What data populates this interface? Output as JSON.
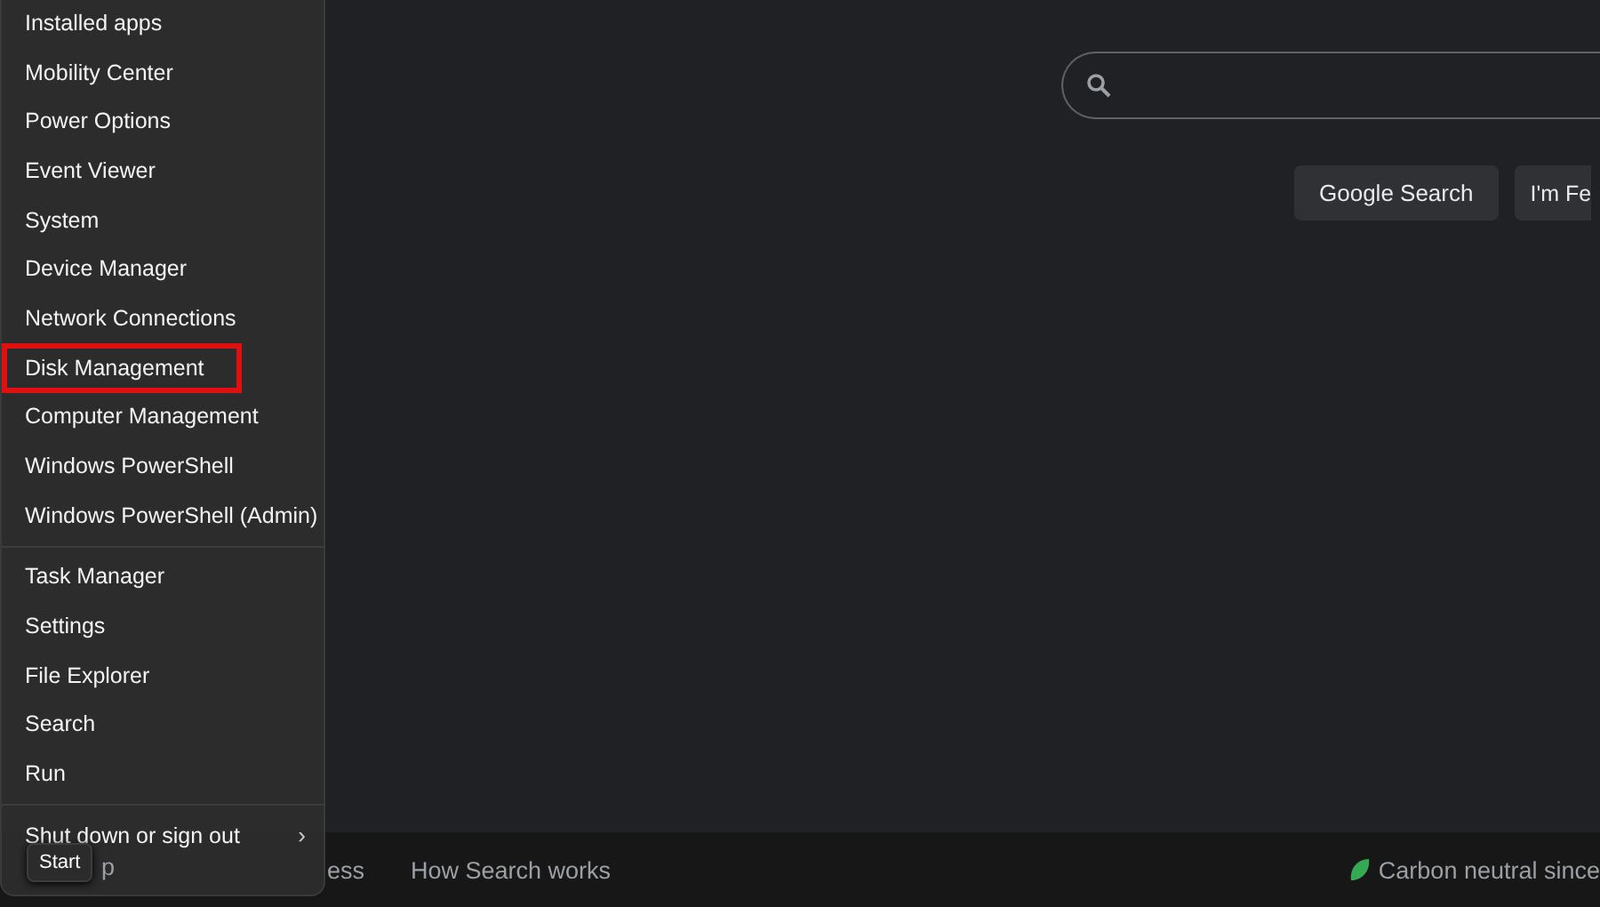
{
  "search_page": {
    "buttons": [
      "Google Search",
      "I'm Fe"
    ]
  },
  "footer": {
    "links": [
      "p",
      "ess",
      "How Search works"
    ],
    "carbon": "Carbon neutral since"
  },
  "start_menu": {
    "groups": [
      {
        "items": [
          {
            "label": "Installed apps",
            "highlighted": false
          },
          {
            "label": "Mobility Center",
            "highlighted": false
          },
          {
            "label": "Power Options",
            "highlighted": false
          },
          {
            "label": "Event Viewer",
            "highlighted": false
          },
          {
            "label": "System",
            "highlighted": false
          },
          {
            "label": "Device Manager",
            "highlighted": false
          },
          {
            "label": "Network Connections",
            "highlighted": false
          },
          {
            "label": "Disk Management",
            "highlighted": true
          },
          {
            "label": "Computer Management",
            "highlighted": false
          },
          {
            "label": "Windows PowerShell",
            "highlighted": false
          },
          {
            "label": "Windows PowerShell (Admin)",
            "highlighted": false
          }
        ]
      },
      {
        "items": [
          {
            "label": "Task Manager",
            "highlighted": false
          },
          {
            "label": "Settings",
            "highlighted": false
          },
          {
            "label": "File Explorer",
            "highlighted": false
          },
          {
            "label": "Search",
            "highlighted": false
          },
          {
            "label": "Run",
            "highlighted": false
          }
        ]
      },
      {
        "items": [
          {
            "label": "Shut down or sign out",
            "highlighted": false,
            "submenu": true,
            "chevron": "›"
          }
        ]
      }
    ]
  },
  "tooltip": "Start"
}
